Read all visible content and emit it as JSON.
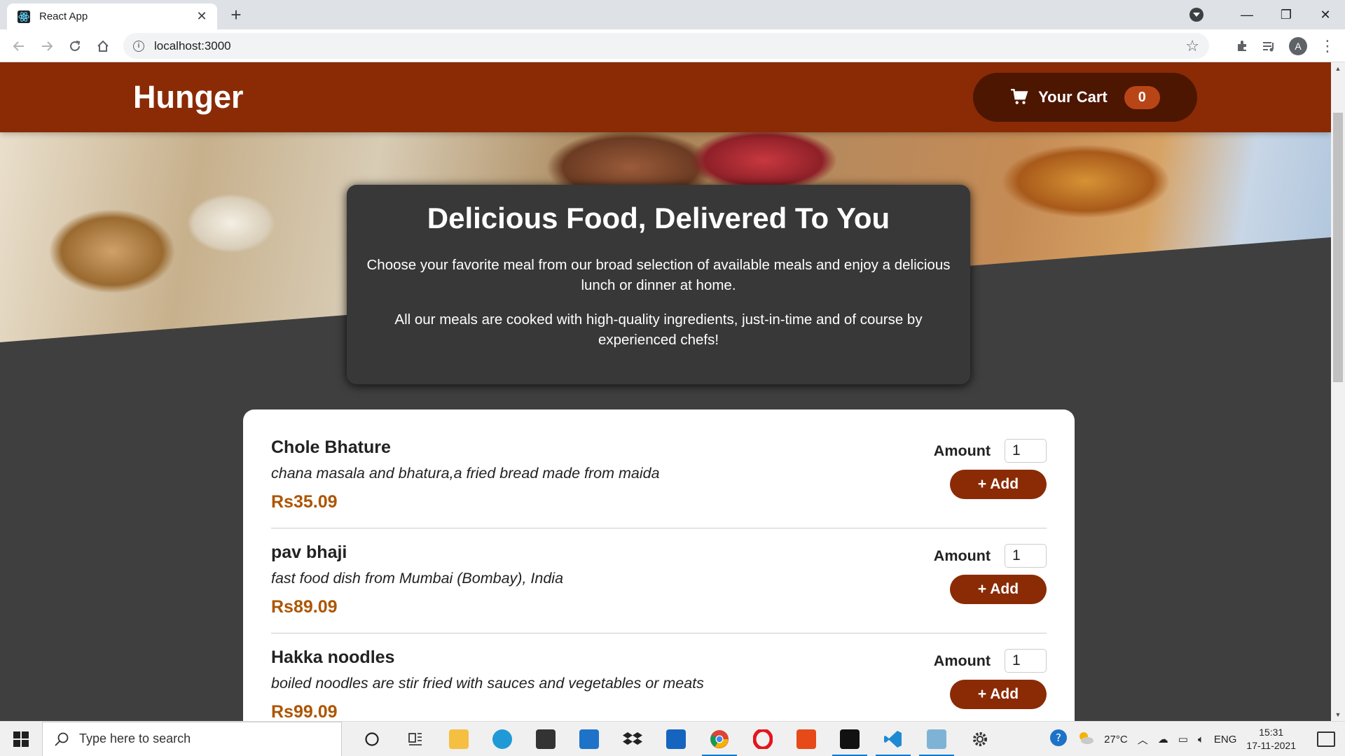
{
  "browser": {
    "tab_title": "React App",
    "tab_close": "✕",
    "new_tab": "+",
    "url": "localhost:3000",
    "profile_initial": "A",
    "minimize": "—",
    "restore": "❐",
    "close": "✕"
  },
  "header": {
    "brand": "Hunger",
    "cart_label": "Your Cart",
    "cart_count": "0"
  },
  "summary": {
    "title": "Delicious Food, Delivered To You",
    "para1": "Choose your favorite meal from our broad selection of available meals and enjoy a delicious lunch or dinner at home.",
    "para2": "All our meals are cooked with high-quality ingredients, just-in-time and of course by experienced chefs!"
  },
  "meals": [
    {
      "name": "Chole Bhature",
      "description": "chana masala and bhatura,a fried bread made from maida",
      "price": "Rs35.09",
      "amount_label": "Amount",
      "amount": "1",
      "add_label": "+ Add"
    },
    {
      "name": "pav bhaji",
      "description": "fast food dish from Mumbai (Bombay), India",
      "price": "Rs89.09",
      "amount_label": "Amount",
      "amount": "1",
      "add_label": "+ Add"
    },
    {
      "name": "Hakka noodles",
      "description": "boiled noodles are stir fried with sauces and vegetables or meats",
      "price": "Rs99.09",
      "amount_label": "Amount",
      "amount": "1",
      "add_label": "+ Add"
    }
  ],
  "taskbar": {
    "search_placeholder": "Type here to search",
    "weather": "27°C",
    "language": "ENG",
    "time": "15:31",
    "date": "17-11-2021"
  },
  "colors": {
    "header_bg": "#8a2b06",
    "cart_bg": "#4d1601",
    "badge_bg": "#b94517",
    "price": "#ad5502",
    "page_bg": "#3f3f3f"
  }
}
